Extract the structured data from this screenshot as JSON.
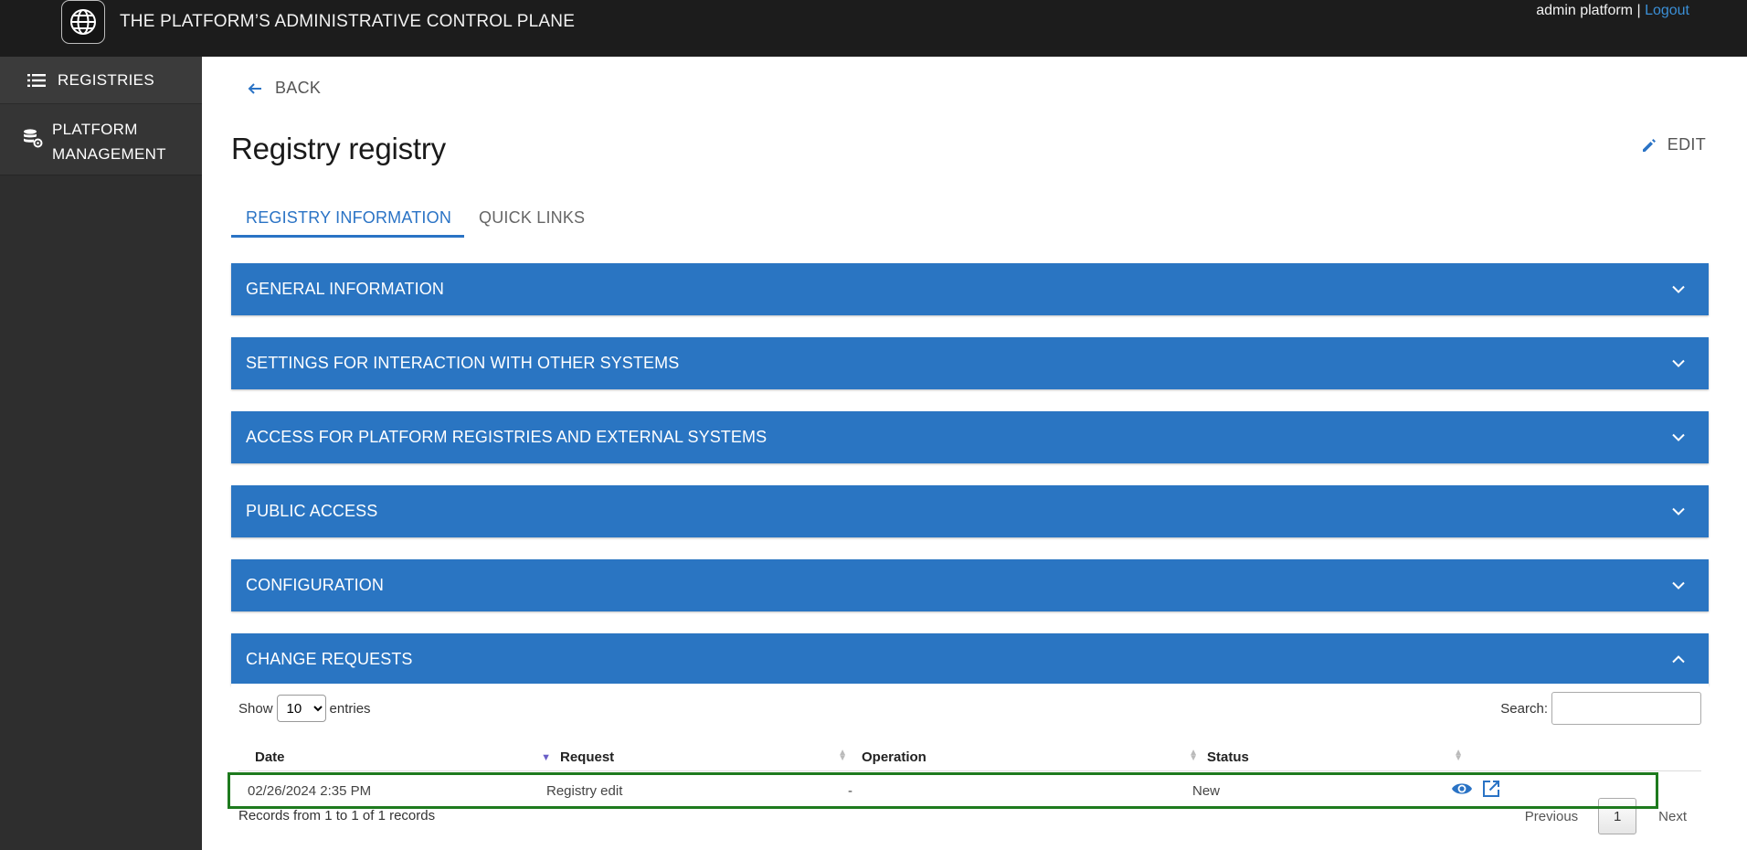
{
  "header": {
    "app_title": "THE PLATFORM’S ADMINISTRATIVE CONTROL PLANE",
    "user_name": "admin platform",
    "separator": " | ",
    "logout_label": "Logout"
  },
  "sidebar": {
    "items": [
      {
        "label": "REGISTRIES",
        "icon": "list-icon"
      },
      {
        "label": "PLATFORM\nMANAGEMENT",
        "icon": "database-gear-icon"
      }
    ]
  },
  "page": {
    "back_label": "BACK",
    "title": "Registry registry",
    "edit_label": "EDIT"
  },
  "tabs": [
    {
      "label": "REGISTRY INFORMATION",
      "active": true
    },
    {
      "label": "QUICK LINKS",
      "active": false
    }
  ],
  "sections": [
    {
      "label": "GENERAL INFORMATION",
      "expanded": false
    },
    {
      "label": "SETTINGS FOR INTERACTION WITH OTHER SYSTEMS",
      "expanded": false
    },
    {
      "label": "ACCESS FOR PLATFORM REGISTRIES AND EXTERNAL SYSTEMS",
      "expanded": false
    },
    {
      "label": "PUBLIC ACCESS",
      "expanded": false
    },
    {
      "label": "CONFIGURATION",
      "expanded": false
    },
    {
      "label": "CHANGE REQUESTS",
      "expanded": true
    }
  ],
  "change_requests": {
    "show_label": "Show",
    "entries_label": "entries",
    "page_length": "10",
    "search_label": "Search:",
    "search_value": "",
    "columns": [
      "Date",
      "Request",
      "Operation",
      "Status"
    ],
    "rows": [
      {
        "date": "02/26/2024 2:35 PM",
        "request": "Registry edit",
        "operation": "-",
        "status": "New"
      }
    ],
    "info": "Records from 1 to 1 of 1 records",
    "pager": {
      "previous": "Previous",
      "current": "1",
      "next": "Next"
    }
  },
  "colors": {
    "topbar": "#1c1c1c",
    "sidebar": "#2e2e2e",
    "accent": "#2a75c2",
    "highlight": "#1e7a1e"
  }
}
